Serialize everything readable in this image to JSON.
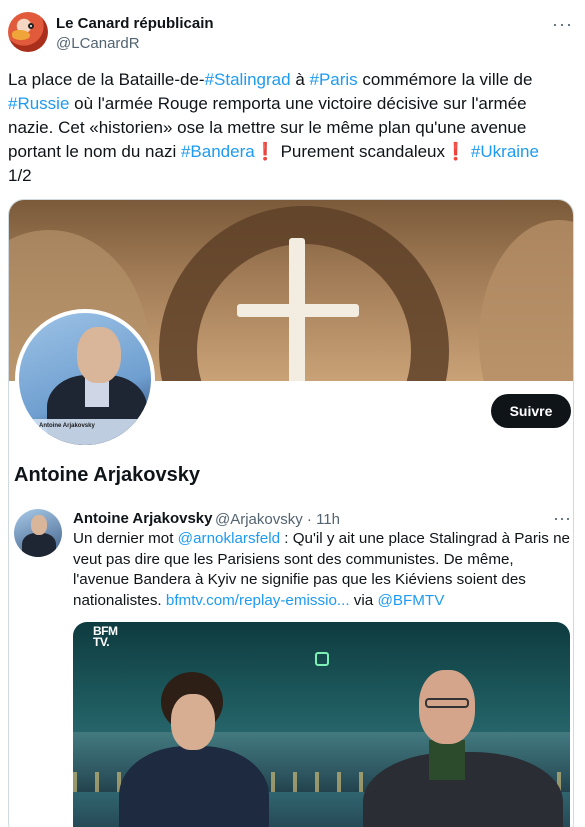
{
  "tweet": {
    "author_name": "Le Canard républicain",
    "author_handle": "@LCanardR",
    "more_icon": "more-horizontal-icon",
    "text_parts": {
      "p1": "La place de la Bataille-de-",
      "t1": "#Stalingrad",
      "p2": " à ",
      "t2": "#Paris",
      "p3": " commémore la ville de ",
      "t3": "#Russie",
      "p4": " où l'armée Rouge remporta une victoire décisive sur l'armée nazie. Cet «historien» ose la mettre sur le même plan qu'une avenue portant le nom du nazi ",
      "t4": "#Bandera",
      "b1": "❗",
      "p5": " Purement scandaleux",
      "b2": "❗",
      "p6": " ",
      "t5": "#Ukraine",
      "p7": "1/2"
    }
  },
  "profile_card": {
    "name": "Antoine Arjakovsky",
    "follow_label": "Suivre",
    "photo_caption": "Antoine Arjakovsky"
  },
  "quoted": {
    "name": "Antoine Arjakovsky",
    "handle_time": "@Arjakovsky · 11h",
    "more_icon": "more-horizontal-icon",
    "parts": {
      "q1": "Un dernier mot ",
      "m1": "@arnoklarsfeld",
      "q2": " : Qu'il y ait une place Stalingrad à Paris ne veut pas dire que les Parisiens sont des communistes. De même, l'avenue Bandera à Kyiv ne signifie pas que les Kiéviens soient des nationalistes. ",
      "l1": "bfmtv.com/replay-emissio...",
      "q3": " via ",
      "m2": "@BFMTV"
    },
    "video_logo_line1": "BFM",
    "video_logo_line2": "TV."
  },
  "colors": {
    "link": "#1d9bf0",
    "text": "#0f1419",
    "muted": "#536471",
    "border": "#cfd9de",
    "alert": "#d21f3c"
  }
}
